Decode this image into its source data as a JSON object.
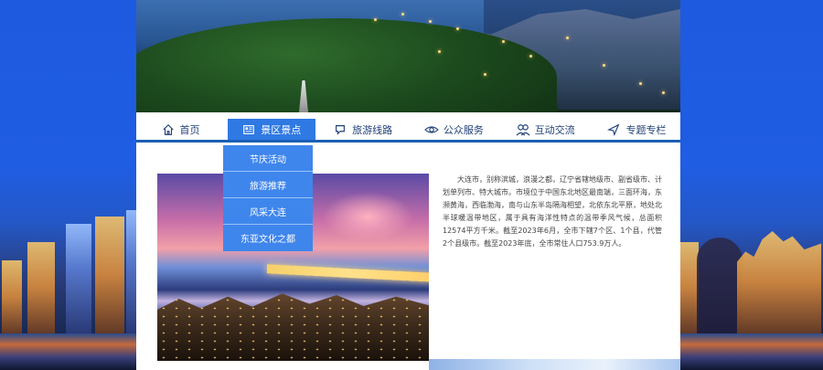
{
  "nav": {
    "items": [
      {
        "label": "首页",
        "icon": "home-icon"
      },
      {
        "label": "景区景点",
        "icon": "newspaper-icon",
        "active": true
      },
      {
        "label": "旅游线路",
        "icon": "chat-bubble-icon"
      },
      {
        "label": "公众服务",
        "icon": "eye-icon"
      },
      {
        "label": "互动交流",
        "icon": "users-icon"
      },
      {
        "label": "专题专栏",
        "icon": "send-icon"
      }
    ]
  },
  "dropdown": {
    "items": [
      "节庆活动",
      "旅游推荐",
      "风采大连",
      "东亚文化之都"
    ]
  },
  "intro": {
    "text": "大连市，别称滨城，浪漫之都，辽宁省辖地级市、副省级市、计划单列市、特大城市。市境位于中国东北地区最南端，三面环海，东濒黄海，西临渤海，南与山东半岛隔海相望，北依东北平原，地处北半球暖温带地区，属于具有海洋性特点的温带季风气候，总面积12574平方千米。截至2023年6月，全市下辖7个区、1个县，代管2个县级市。截至2023年底，全市常住人口753.9万人。"
  },
  "colors": {
    "nav_accent": "#1a5fb4",
    "active_tab": "#2f79e3",
    "dropdown_bg": "#3f86ec",
    "background": "#1f5fe0"
  }
}
